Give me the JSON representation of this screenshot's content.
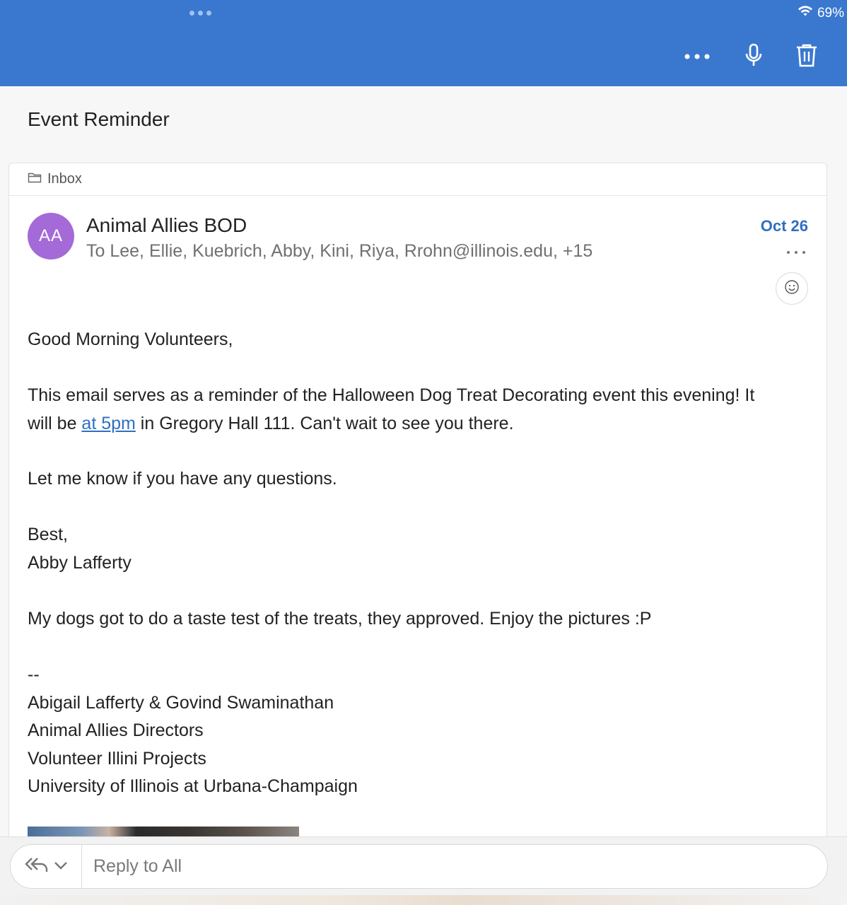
{
  "status_bar": {
    "battery": "69%"
  },
  "toolbar": {
    "more_icon": "more-horizontal-icon",
    "mic_icon": "microphone-icon",
    "trash_icon": "trash-icon"
  },
  "email": {
    "subject": "Event Reminder",
    "folder": "Inbox",
    "avatar_initials": "AA",
    "sender": "Animal Allies BOD",
    "recipients": "To Lee, Ellie, Kuebrich, Abby, Kini, Riya, Rrohn@illinois.edu, +15",
    "date": "Oct 26",
    "body": {
      "greeting": "Good Morning Volunteers,",
      "para1_line1": "This email serves as a reminder of the Halloween Dog Treat Decorating event this evening! It",
      "para1_line2_pre": "will be ",
      "para1_link": "at 5pm",
      "para1_line2_post": " in Gregory Hall 111. Can't wait to see you there.",
      "para2": "Let me know if you have any questions.",
      "closing": "Best,",
      "name": "Abby Lafferty",
      "para3": "My dogs got to do a taste test of the treats, they approved. Enjoy the pictures :P",
      "sig_sep": "--",
      "sig_line1": "Abigail Lafferty & Govind Swaminathan",
      "sig_line2": "Animal Allies Directors",
      "sig_line3": "Volunteer Illini Projects",
      "sig_line4": "University of Illinois at Urbana-Champaign"
    }
  },
  "reply": {
    "placeholder": "Reply to All"
  },
  "colors": {
    "header": "#3a78cf",
    "accent": "#2f6fc1",
    "avatar": "#a46ad7"
  }
}
